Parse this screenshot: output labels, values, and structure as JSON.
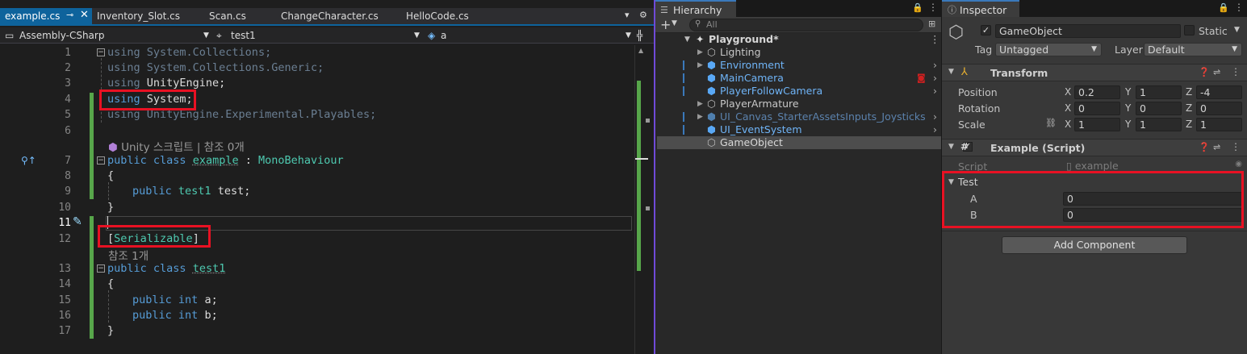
{
  "editor": {
    "tabs": [
      {
        "label": "example.cs",
        "active": true
      },
      {
        "label": "Inventory_Slot.cs"
      },
      {
        "label": "Scan.cs"
      },
      {
        "label": "ChangeCharacter.cs"
      },
      {
        "label": "HelloCode.cs"
      }
    ],
    "nav": {
      "project": "Assembly-CSharp",
      "class": "test1",
      "member": "a"
    },
    "hint_refs_line": "Unity 스크립트 | 참조 0개",
    "hint_refs_line2": "참조 1개",
    "line_numbers": [
      "1",
      "2",
      "3",
      "4",
      "5",
      "6",
      "7",
      "8",
      "9",
      "10",
      "11",
      "12",
      "13",
      "14",
      "15",
      "16",
      "17"
    ],
    "lines": {
      "l1": [
        "using",
        " System.Collections;"
      ],
      "l2": [
        "using",
        " System.Collections.Generic;"
      ],
      "l3": [
        "using",
        " UnityEngine;"
      ],
      "l4": [
        "using",
        " System;"
      ],
      "l5": [
        "using",
        " UnityEngine.Experimental.Playables;"
      ],
      "l7": [
        "public",
        " ",
        "class",
        " ",
        "example",
        " : ",
        "MonoBehaviour"
      ],
      "l8": "{",
      "l9": [
        "public",
        " ",
        "test1",
        " test;"
      ],
      "l10": "}",
      "l12": [
        "[",
        "Serializable",
        "]"
      ],
      "l13": [
        "public",
        " ",
        "class",
        " ",
        "test1"
      ],
      "l14": "{",
      "l15": [
        "public",
        " ",
        "int",
        " a;"
      ],
      "l16": [
        "public",
        " ",
        "int",
        " b;"
      ],
      "l17": "}"
    },
    "colors": {
      "keyword": "#569cd6",
      "type": "#4ec9b0",
      "highlight_box": "#e81123",
      "change_bar": "#57a64a"
    }
  },
  "hierarchy": {
    "title": "Hierarchy",
    "search_placeholder": "All",
    "scene": "Playground*",
    "items": [
      {
        "label": "Lighting"
      },
      {
        "label": "Environment"
      },
      {
        "label": "MainCamera"
      },
      {
        "label": "PlayerFollowCamera"
      },
      {
        "label": "PlayerArmature"
      },
      {
        "label": "UI_Canvas_StarterAssetsInputs_Joysticks"
      },
      {
        "label": "UI_EventSystem"
      },
      {
        "label": "GameObject",
        "selected": true
      }
    ]
  },
  "inspector": {
    "title": "Inspector",
    "object_name": "GameObject",
    "static_label": "Static",
    "tag_label": "Tag",
    "tag_value": "Untagged",
    "layer_label": "Layer",
    "layer_value": "Default",
    "transform": {
      "title": "Transform",
      "position": {
        "label": "Position",
        "x": "0.2",
        "y": "1",
        "z": "-4"
      },
      "rotation": {
        "label": "Rotation",
        "x": "0",
        "y": "0",
        "z": "0"
      },
      "scale": {
        "label": "Scale",
        "x": "1",
        "y": "1",
        "z": "1"
      }
    },
    "axis": {
      "x": "X",
      "y": "Y",
      "z": "Z"
    },
    "script_component": {
      "title": "Example (Script)",
      "script_label": "Script",
      "script_value": "example",
      "test_label": "Test",
      "a_label": "A",
      "a_value": "0",
      "b_label": "B",
      "b_value": "0"
    },
    "add_component": "Add Component"
  }
}
